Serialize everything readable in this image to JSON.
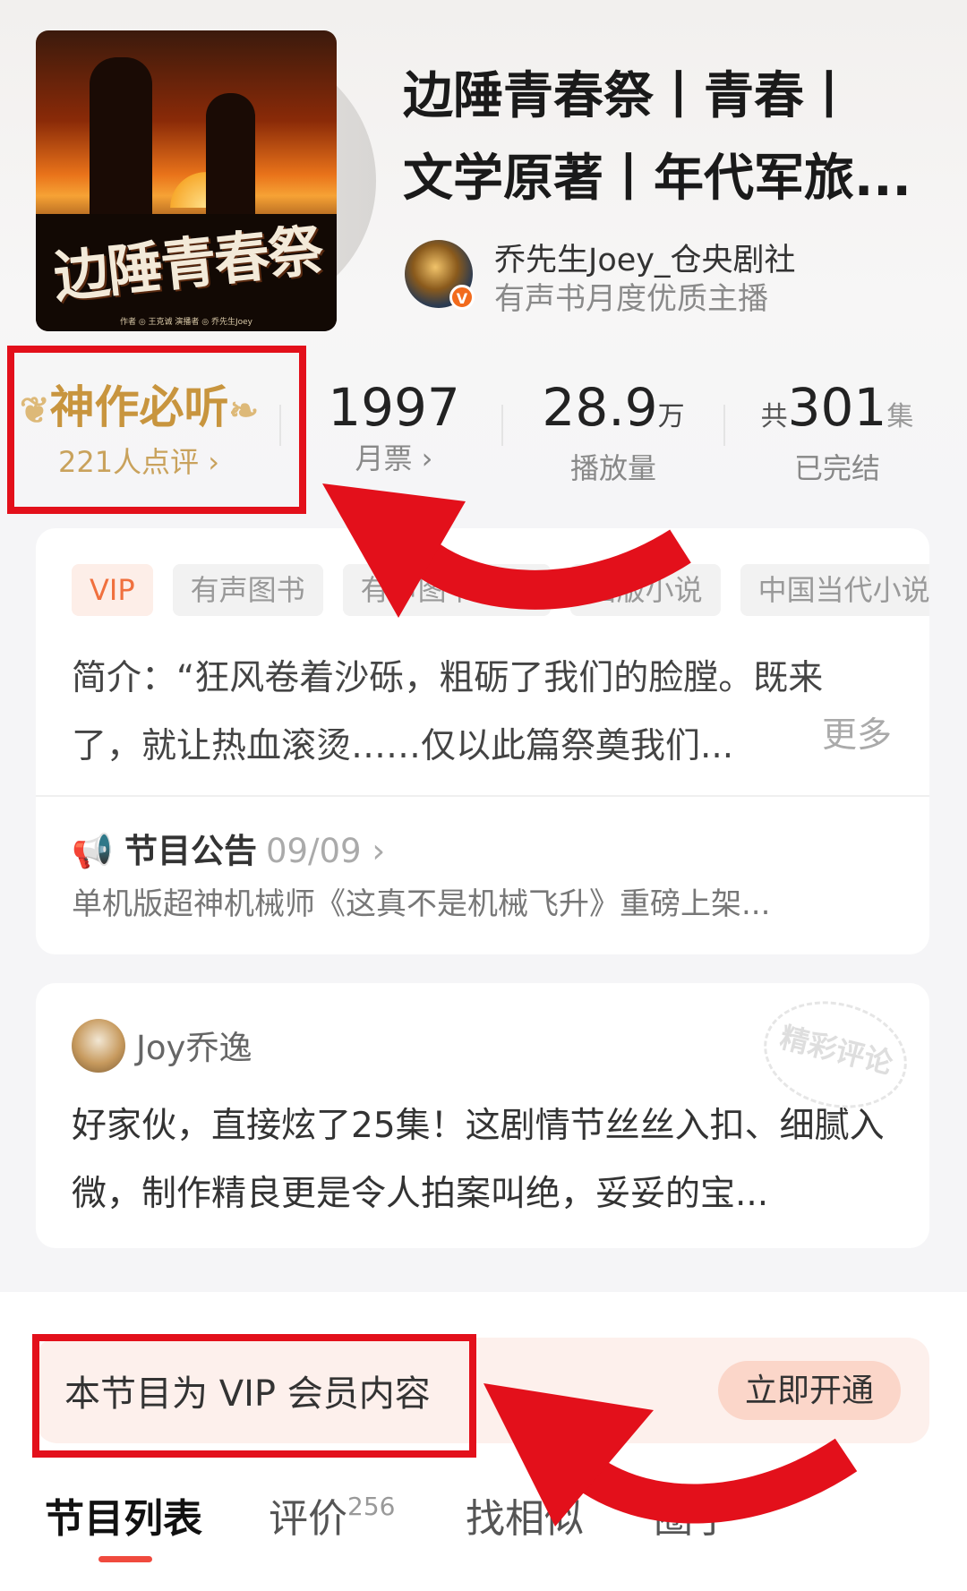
{
  "book": {
    "title_line1": "边陲青春祭丨青春丨",
    "title_line2": "文学原著丨年代军旅...",
    "cover_title": "边陲青春祭",
    "cover_credit": "作者 ◎ 王克诚   演播者 ◎ 乔先生Joey"
  },
  "anchor": {
    "name": "乔先生Joey_仓央剧社",
    "subtitle": "有声书月度优质主播",
    "badge": "V"
  },
  "stats": {
    "rating_label": "神作必听",
    "reviewers": "221人点评 ›",
    "votes_value": "1997",
    "votes_label": "月票 ›",
    "plays_value": "28.9",
    "plays_unit": "万",
    "plays_label": "播放量",
    "episodes_prefix": "共",
    "episodes_value": "301",
    "episodes_unit": "集",
    "episodes_status": "已完结"
  },
  "tags": [
    "VIP",
    "有声图书",
    "有声图书另类",
    "出版小说",
    "中国当代小说"
  ],
  "intro": {
    "text": "简介：“狂风卷着沙砾，粗砺了我们的脸膛。既来了，就让热血滚烫……仅以此篇祭奠我们...",
    "more": "更多"
  },
  "notice": {
    "title": "节目公告",
    "date": "09/09 ›",
    "body": "单机版超神机械师《这真不是机械飞升》重磅上架..."
  },
  "comment": {
    "user": "Joy乔逸",
    "text": "好家伙，直接炫了25集！这剧情节丝丝入扣、细腻入微，制作精良更是令人拍案叫绝，妥妥的宝...",
    "stamp": "精彩评论"
  },
  "vip": {
    "text": "本节目为 VIP 会员内容",
    "button": "立即开通"
  },
  "tabs": {
    "list": "节目列表",
    "reviews": "评价",
    "reviews_count": "256",
    "similar": "找相似",
    "fans": "圈子"
  },
  "colors": {
    "accent_red": "#e3101b",
    "gold": "#c8953e",
    "vip_orange": "#f0703e"
  }
}
